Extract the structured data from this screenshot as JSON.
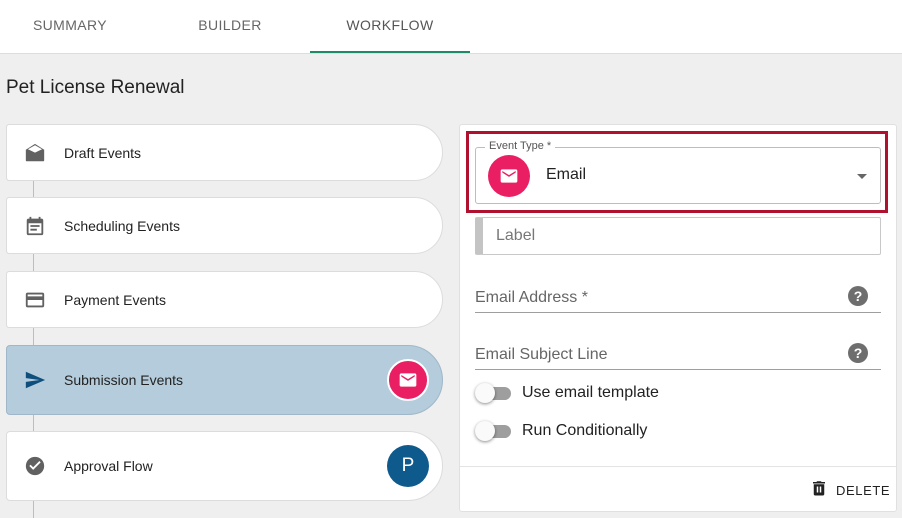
{
  "tabs": [
    {
      "label": "SUMMARY"
    },
    {
      "label": "BUILDER"
    },
    {
      "label": "WORKFLOW"
    }
  ],
  "active_tab": "WORKFLOW",
  "page_title": "Pet License Renewal",
  "events": [
    {
      "label": "Draft Events",
      "icon": "envelope-open-icon"
    },
    {
      "label": "Scheduling Events",
      "icon": "calendar-icon"
    },
    {
      "label": "Payment Events",
      "icon": "credit-card-icon"
    },
    {
      "label": "Submission Events",
      "icon": "send-icon",
      "selected": true,
      "badge": "email-icon"
    },
    {
      "label": "Approval Flow",
      "icon": "check-circle-icon",
      "badge_text": "P"
    }
  ],
  "panel": {
    "event_type": {
      "legend": "Event Type *",
      "value": "Email",
      "icon": "email-icon"
    },
    "label_placeholder": "Label",
    "email_address_placeholder": "Email Address *",
    "email_subject_placeholder": "Email Subject Line",
    "help_glyph": "?",
    "toggles": [
      {
        "label": "Use email template",
        "on": false
      },
      {
        "label": "Run Conditionally",
        "on": false
      }
    ],
    "delete_label": "DELETE"
  },
  "colors": {
    "accent_tab": "#1f8a6a",
    "pink": "#e91e63",
    "selected_row": "#b5ccdc",
    "highlight_box": "#b0112f",
    "approval_badge": "#0f5a8c"
  }
}
